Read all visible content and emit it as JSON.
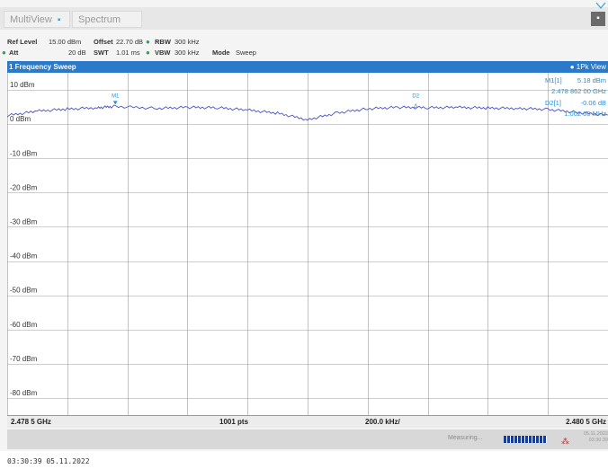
{
  "tabs": [
    {
      "label": "MultiView",
      "close": "▪"
    },
    {
      "label": "Spectrum"
    }
  ],
  "settings": {
    "ref_level_label": "Ref Level",
    "ref_level_value": "15.00 dBm",
    "offset_label": "Offset",
    "offset_value": "22.70 dB",
    "rbw_label": "RBW",
    "rbw_value": "300 kHz",
    "att_label": "Att",
    "att_value": "20 dB",
    "swt_label": "SWT",
    "swt_value": "1.01 ms",
    "vbw_label": "VBW",
    "vbw_value": "300 kHz",
    "mode_label": "Mode",
    "mode_value": "Sweep"
  },
  "window": {
    "title": "1 Frequency Sweep",
    "trace_label": "1Pk View"
  },
  "markers": {
    "m1_id": "M1[1]",
    "m1_level": "5.18 dBm",
    "m1_freq": "2.478 862 00 GHz",
    "d2_id": "D2[1]",
    "d2_level": "-0.06 dB",
    "d2_freq": "1.002 00 MHz",
    "m1_tag": "M1",
    "d2_tag": "D2"
  },
  "chart_data": {
    "type": "line",
    "ylabel_ticks": [
      "10 dBm",
      "0 dBm",
      "-10 dBm",
      "-20 dBm",
      "-30 dBm",
      "-40 dBm",
      "-50 dBm",
      "-60 dBm",
      "-70 dBm",
      "-80 dBm"
    ],
    "ylim": [
      -85,
      15
    ],
    "xlim_ghz": [
      2.4785,
      2.4805
    ],
    "grid": true,
    "series": [
      {
        "x_ghz": [
          2.4785,
          2.4786,
          2.4787,
          2.4788,
          2.47886,
          2.479,
          2.4791,
          2.4792,
          2.4793,
          2.4794,
          2.4795,
          2.4796,
          2.4797,
          2.4798,
          2.4799,
          2.48,
          2.4801,
          2.4802,
          2.4803,
          2.4804,
          2.4805
        ],
        "y_dbm": [
          2.5,
          3.8,
          4.4,
          4.8,
          5.18,
          4.6,
          4.9,
          4.8,
          4.1,
          3.2,
          1.3,
          3.3,
          4.5,
          4.9,
          4.8,
          4.9,
          4.7,
          4.6,
          4.3,
          3.4,
          2.6
        ]
      }
    ],
    "marker_points": [
      {
        "label": "M1",
        "x_ghz": 2.47886,
        "y_dbm": 5.18
      },
      {
        "label": "D2",
        "x_ghz": 2.47986,
        "y_dbm": 5.12
      }
    ]
  },
  "bottom": {
    "start": "2.478 5 GHz",
    "points": "1001 pts",
    "span": "200.0 kHz/",
    "stop": "2.480 5 GHz"
  },
  "status": {
    "measuring": "Measuring...",
    "date": "05.11.2022",
    "time": "03:30:39"
  },
  "footer_timestamp": "03:30:39  05.11.2022"
}
